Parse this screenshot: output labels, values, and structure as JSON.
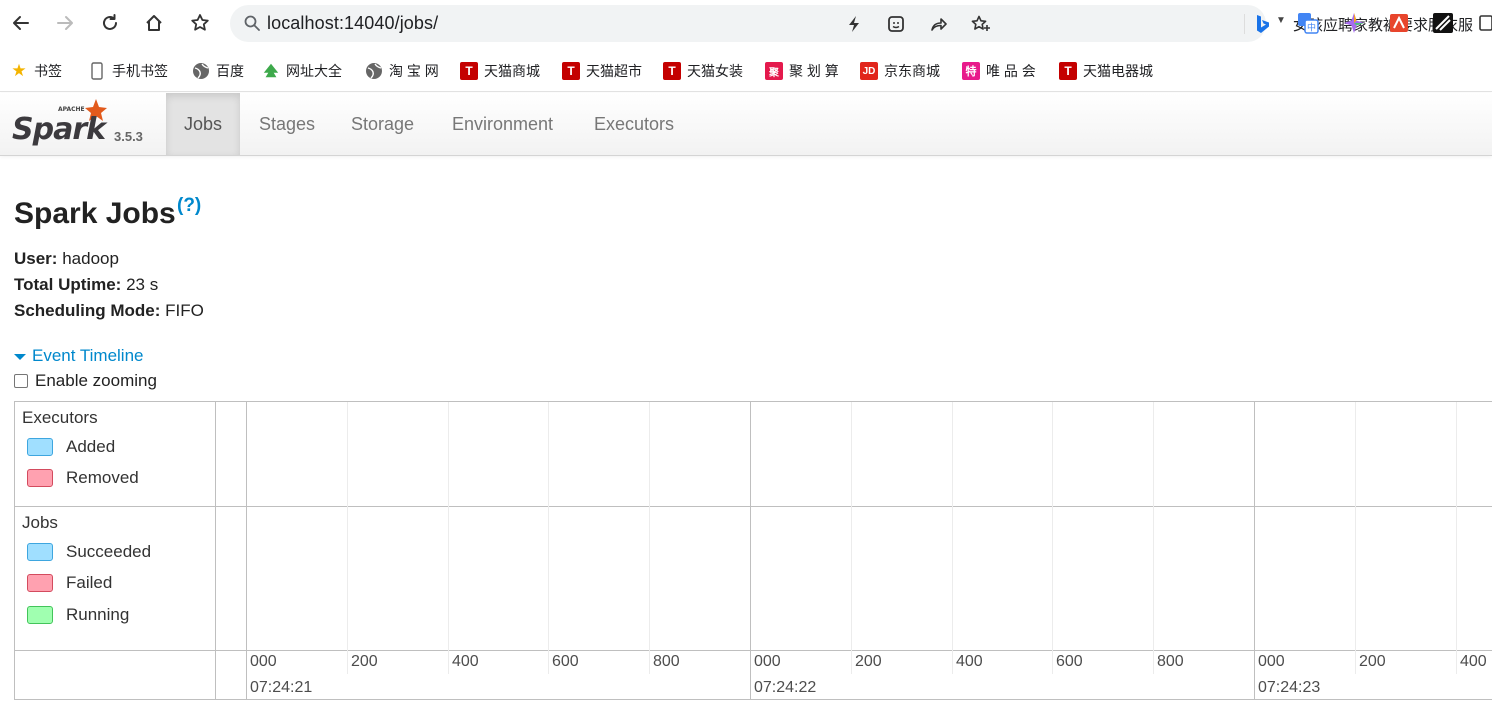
{
  "browser": {
    "url": "localhost:14040/jobs/",
    "search_hot": "女孩应聘家教被要求脱衣服"
  },
  "bookmarks": [
    {
      "label": "书签",
      "icon": "star-icon",
      "color": "#f4b400"
    },
    {
      "label": "手机书签",
      "icon": "phone-icon",
      "color": "#555555"
    },
    {
      "label": "百度",
      "icon": "globe-icon",
      "color": "#555555"
    },
    {
      "label": "网址大全",
      "icon": "tree-icon",
      "color": "#2e9a3a"
    },
    {
      "label": "淘 宝 网",
      "icon": "globe-icon",
      "color": "#555555"
    },
    {
      "label": "天猫商城",
      "icon": "tmall-icon",
      "color": "#c40000"
    },
    {
      "label": "天猫超市",
      "icon": "tmall-icon",
      "color": "#c40000"
    },
    {
      "label": "天猫女装",
      "icon": "tmall-icon",
      "color": "#c40000"
    },
    {
      "label": "聚 划 算",
      "icon": "juhuasuan-icon",
      "color": "#e4194c"
    },
    {
      "label": "京东商城",
      "icon": "jd-icon",
      "color": "#e1251b"
    },
    {
      "label": "唯 品 会",
      "icon": "vip-icon",
      "color": "#e81a8b"
    },
    {
      "label": "天猫电器城",
      "icon": "tmall-icon",
      "color": "#c40000"
    }
  ],
  "spark": {
    "version": "3.5.3",
    "tabs": [
      "Jobs",
      "Stages",
      "Storage",
      "Environment",
      "Executors"
    ],
    "active_tab": "Jobs"
  },
  "page": {
    "title": "Spark Jobs",
    "help": "(?)",
    "user_label": "User:",
    "user_value": "hadoop",
    "uptime_label": "Total Uptime:",
    "uptime_value": "23 s",
    "mode_label": "Scheduling Mode:",
    "mode_value": "FIFO",
    "timeline_toggle": "Event Timeline",
    "zoom_label": "Enable zooming"
  },
  "timeline": {
    "executors_title": "Executors",
    "executors_legend": [
      "Added",
      "Removed"
    ],
    "jobs_title": "Jobs",
    "jobs_legend": [
      "Succeeded",
      "Failed",
      "Running"
    ],
    "ticks": [
      "000",
      "200",
      "400",
      "600",
      "800",
      "000",
      "200",
      "400",
      "600",
      "800",
      "000",
      "200",
      "400"
    ],
    "major_labels": [
      "07:24:21",
      "07:24:22",
      "07:24:23"
    ]
  }
}
